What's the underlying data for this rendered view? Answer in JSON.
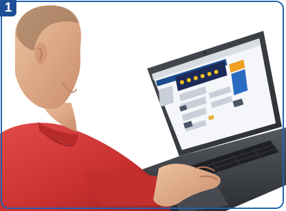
{
  "step_badge": {
    "number": "1"
  },
  "colors": {
    "frame_border": "#1f63b0",
    "badge_bg": "#1d4f96",
    "shirt": "#d23a3a",
    "skin": "#e2b08e",
    "laptop_body": "#3a3d42"
  }
}
